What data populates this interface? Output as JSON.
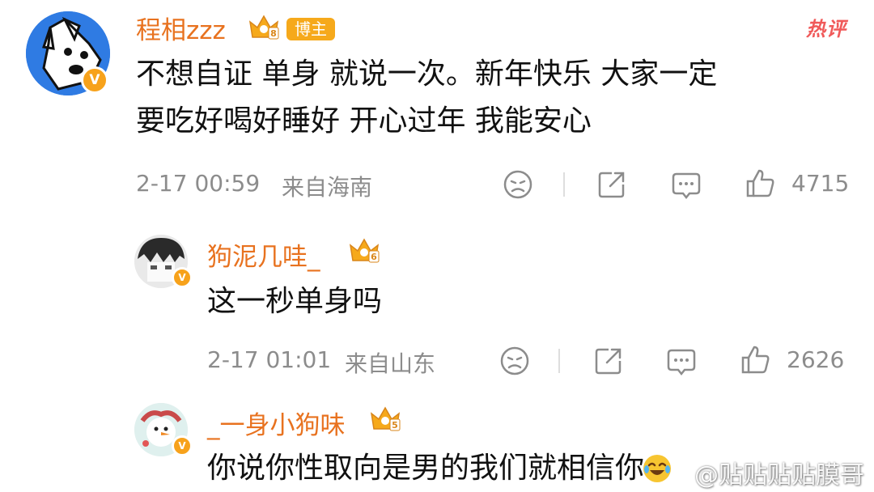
{
  "comments": [
    {
      "username": "程相zzz",
      "level": "8",
      "tag": "博主",
      "hot_label": "热评",
      "content_line1": "不想自证 单身 就说一次。新年快乐 大家一定",
      "content_line2": "要吃好喝好睡好 开心过年 我能安心",
      "time": "2-17 00:59",
      "location": "来自海南",
      "likes": "4715"
    },
    {
      "username": "狗泥几哇_",
      "level": "6",
      "content": "这一秒单身吗",
      "time": "2-17 01:01",
      "location": "来自山东",
      "likes": "2626"
    },
    {
      "username": "_一身小狗味",
      "level": "5",
      "content": "你说你性取向是男的我们就相信你"
    }
  ],
  "watermark": "@贴贴贴贴膜哥",
  "icons": {
    "dislike": "sad-face-icon",
    "share": "share-icon",
    "comment": "comment-icon",
    "like": "thumbs-up-icon",
    "verified": "v-verified-icon",
    "crown": "crown-level-icon"
  },
  "colors": {
    "username": "#e8721f",
    "tag_bg": "#f6a91b",
    "hot": "#f05a5a",
    "meta": "#8c8c8c"
  }
}
